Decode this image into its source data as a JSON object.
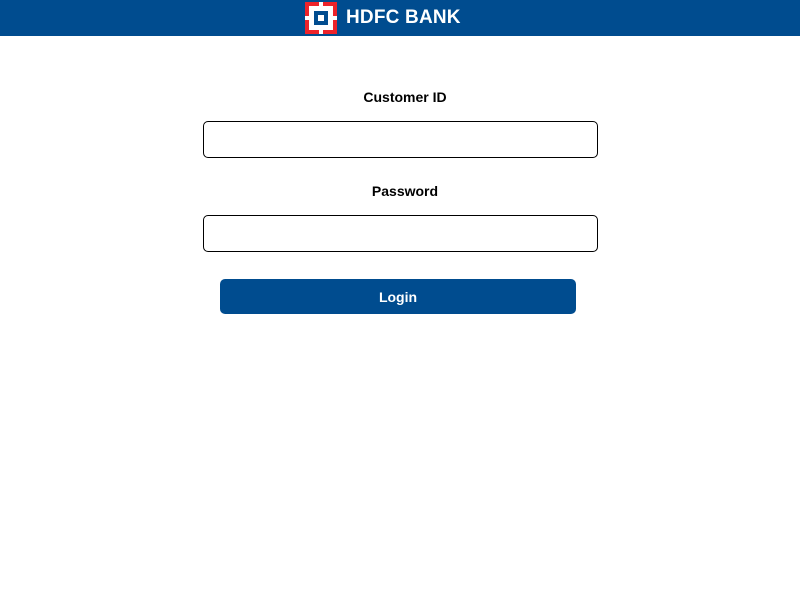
{
  "header": {
    "brand_name": "HDFC BANK",
    "logo_icon": "hdfc-bank-logo-icon",
    "background_color": "#004c8f",
    "logo_color": "#ed232a"
  },
  "login_form": {
    "customer_id_label": "Customer ID",
    "customer_id_value": "",
    "password_label": "Password",
    "password_value": "",
    "login_button_label": "Login",
    "button_color": "#004c8f"
  }
}
